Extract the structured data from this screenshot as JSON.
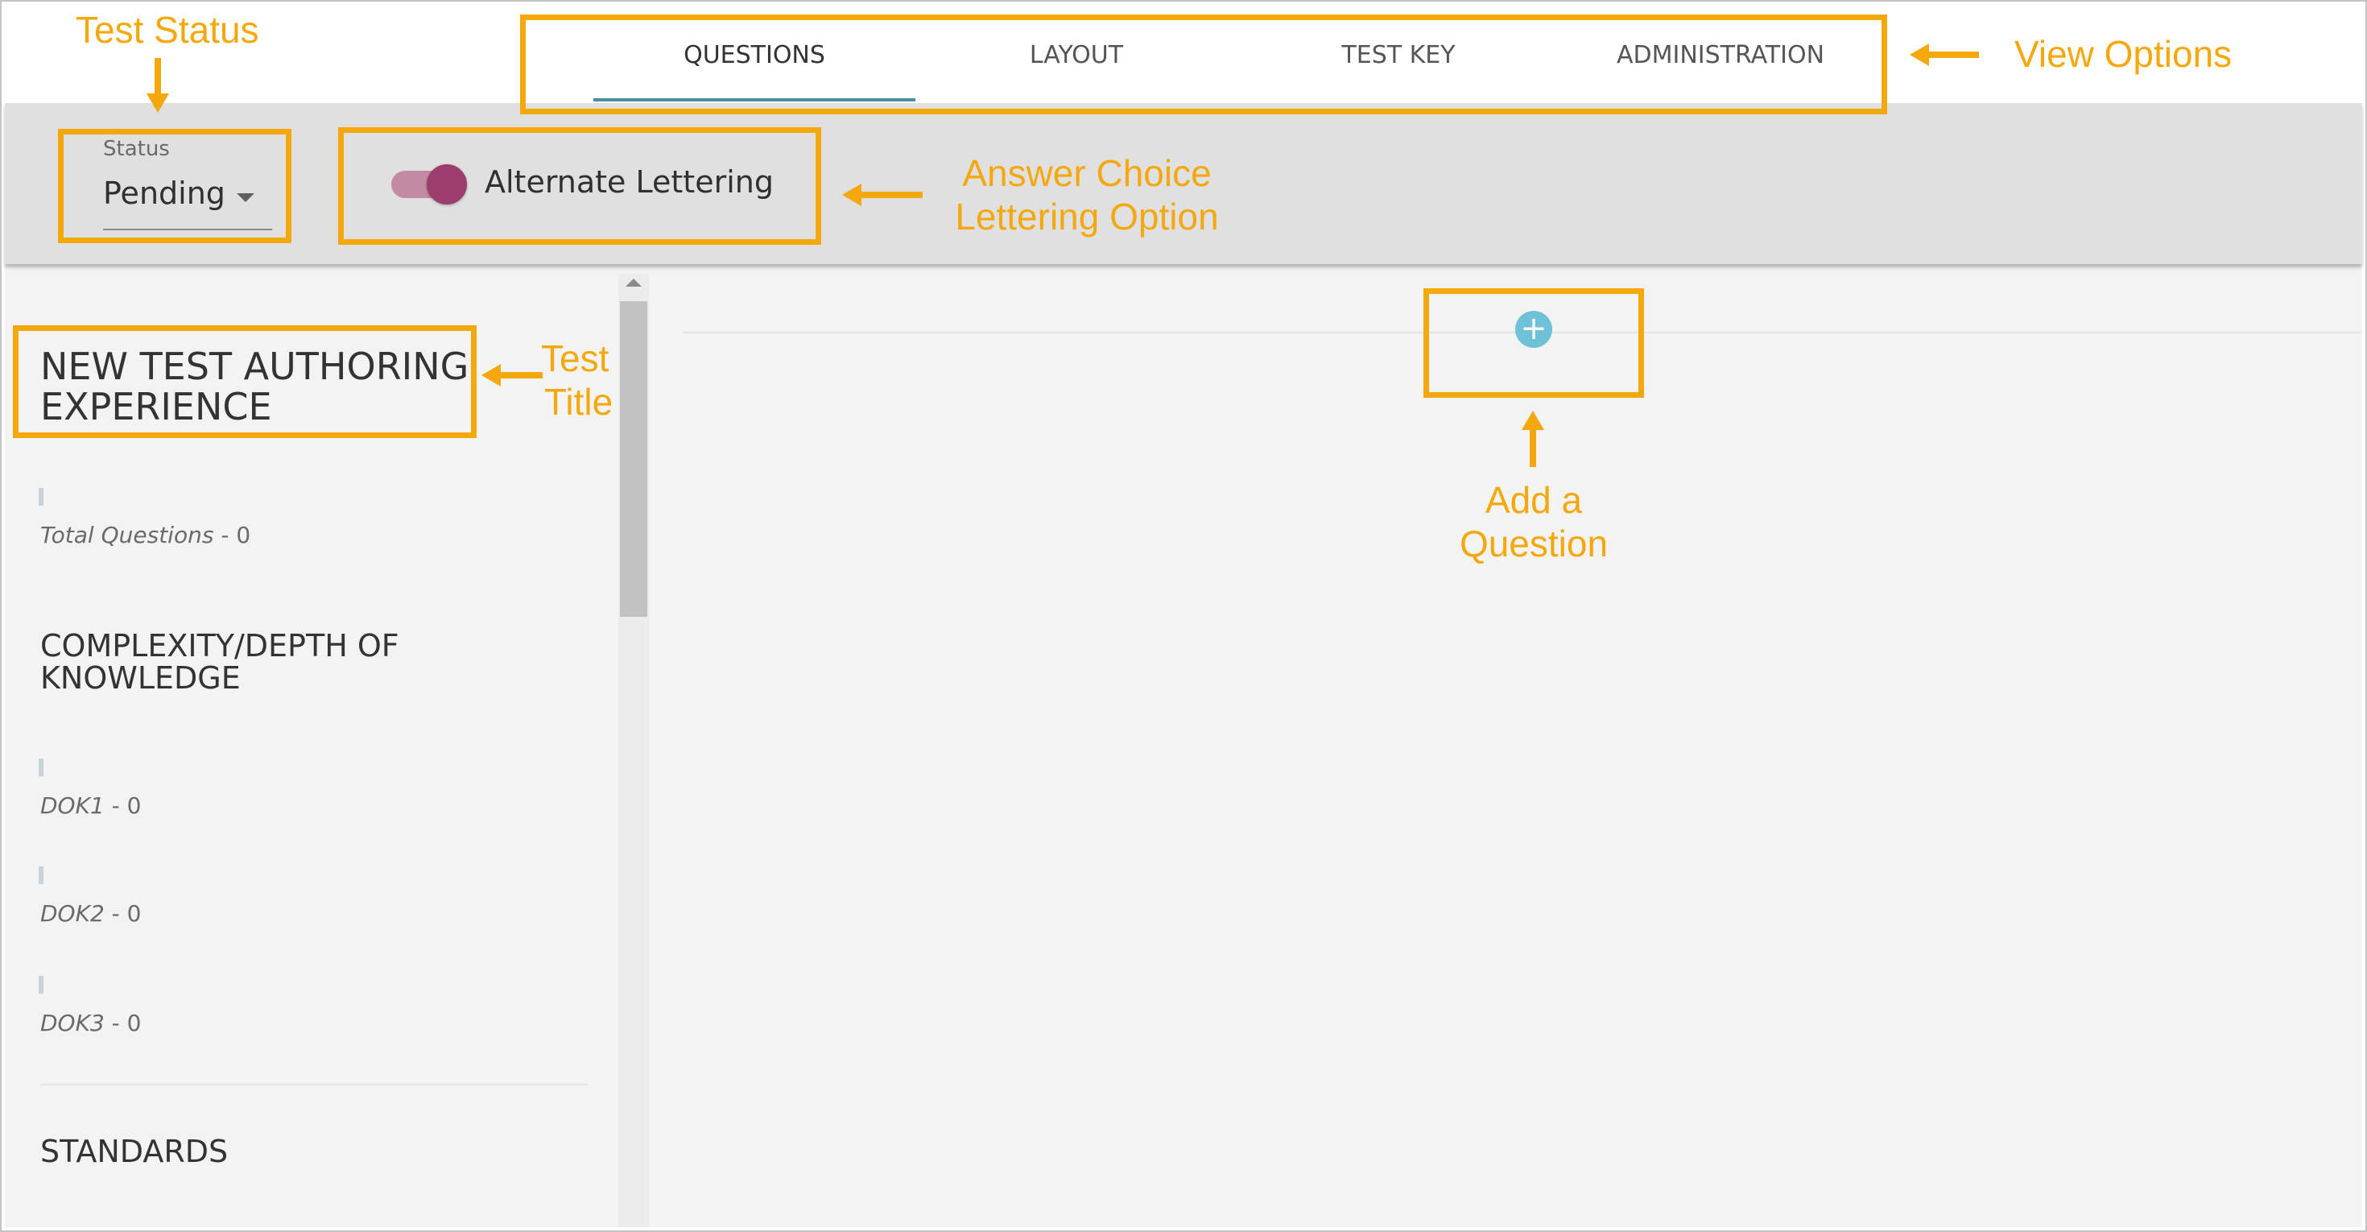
{
  "tabs": [
    {
      "label": "QUESTIONS",
      "active": true
    },
    {
      "label": "LAYOUT",
      "active": false
    },
    {
      "label": "TEST KEY",
      "active": false
    },
    {
      "label": "ADMINISTRATION",
      "active": false
    }
  ],
  "toolbar": {
    "status_label": "Status",
    "status_value": "Pending",
    "toggle_on": true,
    "toggle_label": "Alternate Lettering"
  },
  "sidebar": {
    "test_title_line1": "NEW TEST AUTHORING",
    "test_title_line2": "EXPERIENCE",
    "total_label": "Total Questions",
    "total_value": " - 0",
    "complexity_line1": "COMPLEXITY/DEPTH OF",
    "complexity_line2": "KNOWLEDGE",
    "dok": [
      {
        "label": "DOK1",
        "value": " - 0"
      },
      {
        "label": "DOK2",
        "value": " - 0"
      },
      {
        "label": "DOK3",
        "value": " - 0"
      }
    ],
    "standards_title": "STANDARDS"
  },
  "main": {
    "add_symbol": "+"
  },
  "annotations": {
    "test_status": "Test Status",
    "view_options": "View Options",
    "answer_choice_1": "Answer Choice",
    "answer_choice_2": "Lettering Option",
    "test_title_1": "Test",
    "test_title_2": "Title",
    "add_question_1": "Add a",
    "add_question_2": "Question"
  },
  "colors": {
    "annotation": "#f5a80c",
    "toggle_knob": "#9c3e6d",
    "toggle_track": "#c38aa4",
    "add_button": "#6ec1d6",
    "tab_underline": "#4a8fa0"
  }
}
